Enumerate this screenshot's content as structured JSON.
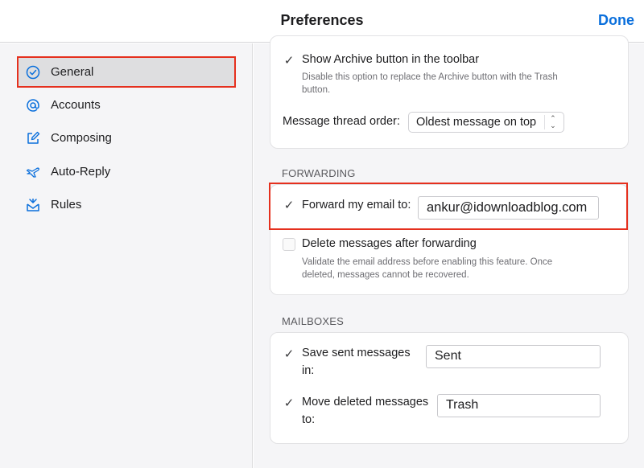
{
  "header": {
    "title": "Preferences",
    "done_label": "Done"
  },
  "sidebar": {
    "items": [
      {
        "label": "General",
        "icon": "checkmark-circle-icon",
        "selected": true
      },
      {
        "label": "Accounts",
        "icon": "at-sign-icon"
      },
      {
        "label": "Composing",
        "icon": "compose-icon"
      },
      {
        "label": "Auto-Reply",
        "icon": "airplane-icon"
      },
      {
        "label": "Rules",
        "icon": "inbox-filter-icon"
      }
    ]
  },
  "general": {
    "show_archive_label": "Show Archive button in the toolbar",
    "show_archive_desc_line1": "Disable this option to replace the Archive button with the Trash",
    "show_archive_desc_line2": "button.",
    "thread_order_label": "Message thread order:",
    "thread_order_value": "Oldest message on top"
  },
  "forwarding": {
    "section_title": "FORWARDING",
    "forward_label": "Forward my email to:",
    "forward_value": "ankur@idownloadblog.com",
    "delete_label": "Delete messages after forwarding",
    "delete_desc_line1": "Validate the email address before enabling this feature. Once",
    "delete_desc_line2": "deleted, messages cannot be recovered."
  },
  "mailboxes": {
    "section_title": "MAILBOXES",
    "save_sent_label_line1": "Save sent messages",
    "save_sent_label_line2": "in:",
    "save_sent_value": "Sent",
    "move_deleted_label_line1": "Move deleted messages",
    "move_deleted_label_line2": "to:",
    "move_deleted_value": "Trash"
  },
  "colors": {
    "accent": "#0a6fdc",
    "highlight": "#e5301e"
  }
}
